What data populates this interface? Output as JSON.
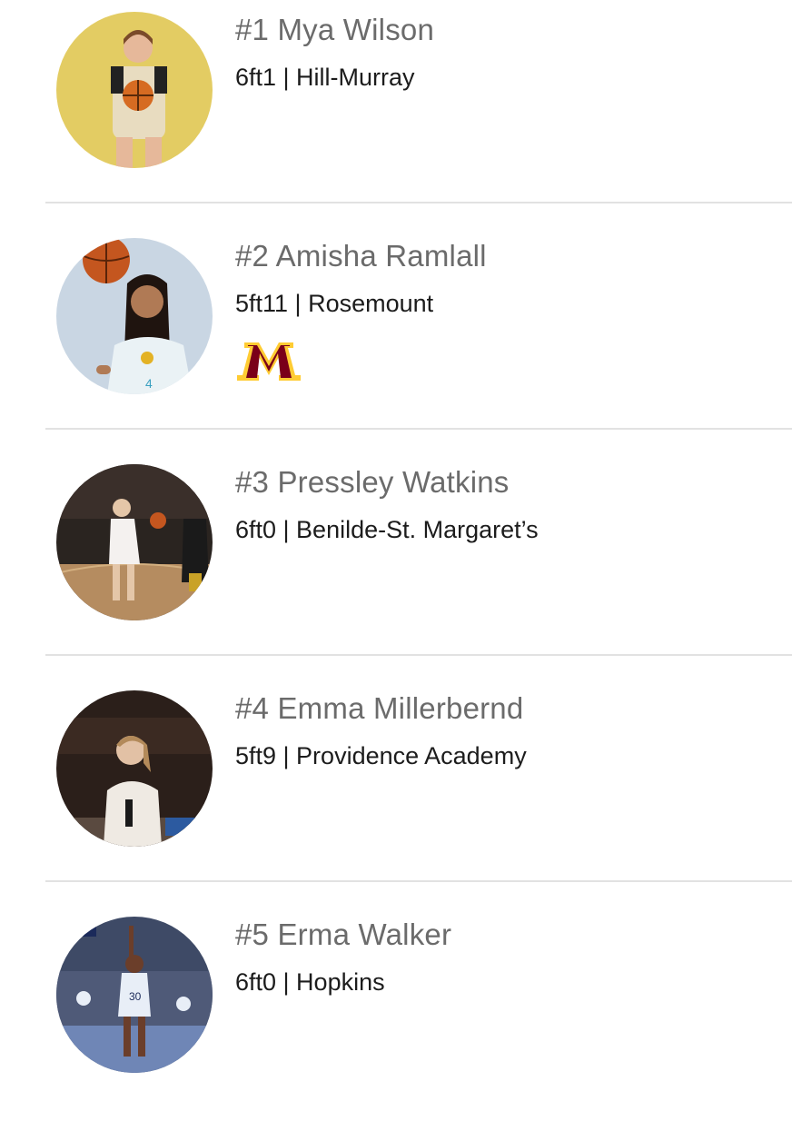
{
  "players": [
    {
      "rank_name": "#1 Mya Wilson",
      "detail": "6ft1 | Hill-Murray",
      "commit_logo": null,
      "photo_bg": "#e3cc63"
    },
    {
      "rank_name": "#2 Amisha Ramlall",
      "detail": "5ft11 | Rosemount",
      "commit_logo": "minnesota-m-logo",
      "photo_bg": "#c9d6e3"
    },
    {
      "rank_name": "#3 Pressley Watkins",
      "detail": "6ft0 | Benilde-St. Margaret’s",
      "commit_logo": null,
      "photo_bg": "#2a2420"
    },
    {
      "rank_name": "#4 Emma Millerbernd",
      "detail": "5ft9 | Providence Academy",
      "commit_logo": null,
      "photo_bg": "#2b1f1a"
    },
    {
      "rank_name": "#5 Erma Walker",
      "detail": "6ft0 | Hopkins",
      "commit_logo": null,
      "photo_bg": "#3e4a66"
    }
  ],
  "colors": {
    "divider": "#e2e2e2",
    "name_text": "#6b6b6b",
    "detail_text": "#1c1c1c",
    "minnesota_maroon": "#7a0019",
    "minnesota_gold": "#ffcc33"
  }
}
